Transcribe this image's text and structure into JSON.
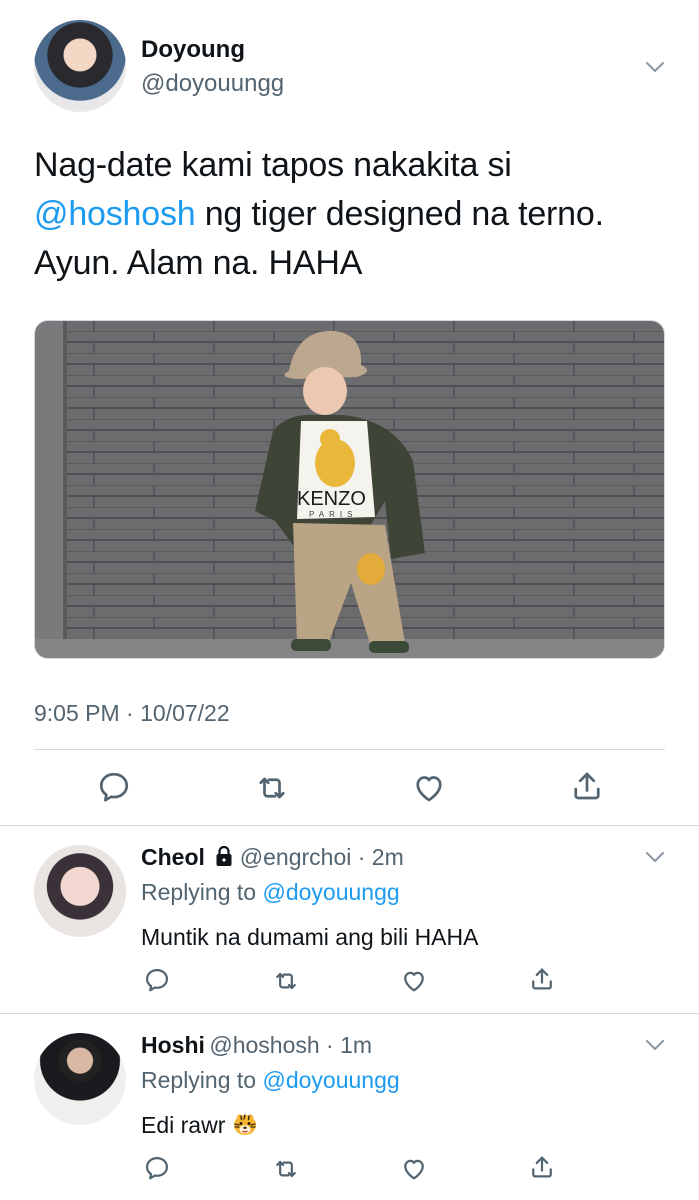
{
  "tweet": {
    "author_name": "Doyoung",
    "author_handle": "@doyouungg",
    "text_parts": {
      "line1": "Nag-date kami tapos nakakita si",
      "mention": "@hoshosh",
      "line2_rest": " ng tiger designed na terno.",
      "line3": "Ayun. Alam na. HAHA"
    },
    "photo": {
      "shirt_text": "KENZO",
      "shirt_subtext": "PARIS"
    },
    "timestamp": "9:05 PM · 10/07/22"
  },
  "replies": [
    {
      "name": "Cheol",
      "locked": true,
      "handle_time": "@engrchoi · 2m",
      "replying_prefix": "Replying to ",
      "replying_to": "@doyouungg",
      "text": "Muntik na dumami ang bili HAHA"
    },
    {
      "name": "Hoshi",
      "locked": false,
      "handle_time": "@hoshosh · 1m",
      "replying_prefix": "Replying to ",
      "replying_to": "@doyouungg",
      "text": "Edi rawr",
      "emoji": "tiger-face-emoji"
    }
  ],
  "icons": {
    "reply": "reply-icon",
    "retweet": "retweet-icon",
    "like": "heart-icon",
    "share": "share-icon",
    "more": "chevron-down-icon",
    "lock": "lock-icon"
  },
  "colors": {
    "link": "#1d9bf0",
    "secondary_text": "#536471",
    "divider": "#cfd9de",
    "primary_text": "#0f1419"
  }
}
